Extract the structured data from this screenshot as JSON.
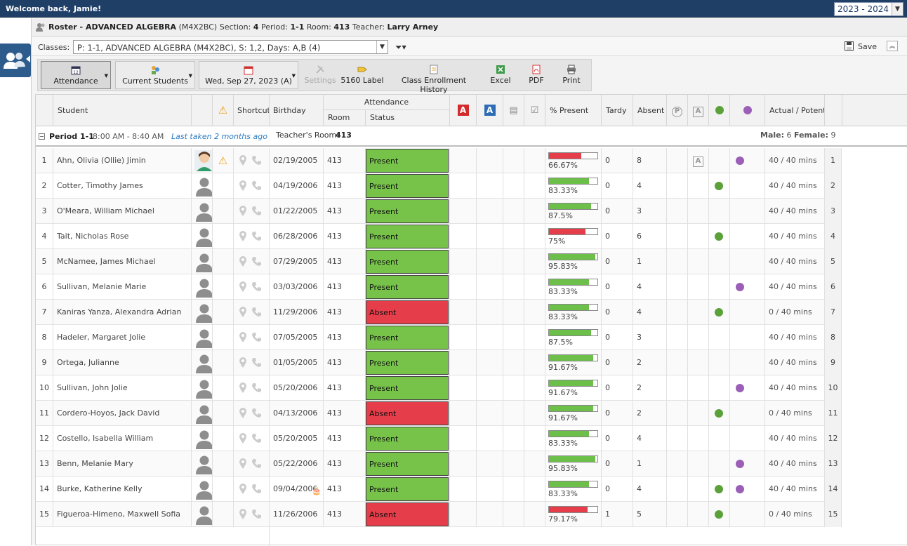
{
  "app": {
    "welcome": "Welcome back, Jamie!",
    "year": "2023 - 2024"
  },
  "title": {
    "prefix": "Roster - ",
    "course": "ADVANCED ALGEBRA",
    "code": "(M4X2BC)",
    "section_label": "Section:",
    "section": "4",
    "period_label": "Period:",
    "period": "1-1",
    "room_label": "Room:",
    "room": "413",
    "teacher_label": "Teacher:",
    "teacher": "Larry Arney"
  },
  "classes": {
    "label": "Classes:",
    "selected": "P: 1-1, ADVANCED ALGEBRA (M4X2BC), S: 1,2, Days: A,B (4)"
  },
  "save_label": "Save",
  "toolbar": {
    "attendance": "Attendance",
    "current_students": "Current Students",
    "date": "Wed, Sep 27, 2023 (A)",
    "settings": "Settings",
    "label5160": "5160 Label",
    "history": "Class Enrollment History",
    "excel": "Excel",
    "pdf": "PDF",
    "print": "Print"
  },
  "columns": {
    "student": "Student",
    "shortcuts": "Shortcuts",
    "birthday": "Birthday",
    "attendance": "Attendance",
    "room": "Room",
    "status": "Status",
    "present_pct": "% Present",
    "tardy": "Tardy",
    "absent": "Absent",
    "actual": "Actual / Potential"
  },
  "period": {
    "name": "Period 1-1",
    "time": "8:00 AM - 8:40 AM",
    "last_taken": "Last taken 2 months ago",
    "teacher_room_label": "Teacher's Room:",
    "teacher_room": "413",
    "male_label": "Male:",
    "male": "6",
    "female_label": "Female:",
    "female": "9"
  },
  "students": [
    {
      "n": "1",
      "name": "Ahn, Olivia (Ollie) Jimin",
      "bday": "02/19/2005",
      "room": "413",
      "status": "Present",
      "pct": "66.67%",
      "pv": 66.67,
      "tardy": "0",
      "absent": "8",
      "warn": true,
      "photo": true,
      "aicon": true,
      "green": false,
      "purple": true,
      "actual": "40",
      "pot": "40 mins"
    },
    {
      "n": "2",
      "name": "Cotter, Timothy James",
      "bday": "04/19/2006",
      "room": "413",
      "status": "Present",
      "pct": "83.33%",
      "pv": 83.33,
      "tardy": "0",
      "absent": "4",
      "green": true,
      "purple": false,
      "actual": "40",
      "pot": "40 mins"
    },
    {
      "n": "3",
      "name": "O'Meara, William Michael",
      "bday": "01/22/2005",
      "room": "413",
      "status": "Present",
      "pct": "87.5%",
      "pv": 87.5,
      "tardy": "0",
      "absent": "3",
      "green": false,
      "purple": false,
      "actual": "40",
      "pot": "40 mins"
    },
    {
      "n": "4",
      "name": "Tait, Nicholas Rose",
      "bday": "06/28/2006",
      "room": "413",
      "status": "Present",
      "pct": "75%",
      "pv": 75,
      "tardy": "0",
      "absent": "6",
      "green": true,
      "purple": false,
      "actual": "40",
      "pot": "40 mins"
    },
    {
      "n": "5",
      "name": "McNamee, James Michael",
      "bday": "07/29/2005",
      "room": "413",
      "status": "Present",
      "pct": "95.83%",
      "pv": 95.83,
      "tardy": "0",
      "absent": "1",
      "green": false,
      "purple": false,
      "actual": "40",
      "pot": "40 mins"
    },
    {
      "n": "6",
      "name": "Sullivan, Melanie Marie",
      "bday": "03/03/2006",
      "room": "413",
      "status": "Present",
      "pct": "83.33%",
      "pv": 83.33,
      "tardy": "0",
      "absent": "4",
      "green": false,
      "purple": true,
      "actual": "40",
      "pot": "40 mins"
    },
    {
      "n": "7",
      "name": "Kaniras Yanza, Alexandra Adrian",
      "bday": "11/29/2006",
      "room": "413",
      "status": "Absent",
      "pct": "83.33%",
      "pv": 83.33,
      "tardy": "0",
      "absent": "4",
      "green": true,
      "purple": false,
      "actual": "0",
      "pot": "40 mins"
    },
    {
      "n": "8",
      "name": "Hadeler, Margaret Jolie",
      "bday": "07/05/2005",
      "room": "413",
      "status": "Present",
      "pct": "87.5%",
      "pv": 87.5,
      "tardy": "0",
      "absent": "3",
      "green": false,
      "purple": false,
      "actual": "40",
      "pot": "40 mins"
    },
    {
      "n": "9",
      "name": "Ortega, Julianne",
      "bday": "01/05/2005",
      "room": "413",
      "status": "Present",
      "pct": "91.67%",
      "pv": 91.67,
      "tardy": "0",
      "absent": "2",
      "green": false,
      "purple": false,
      "actual": "40",
      "pot": "40 mins"
    },
    {
      "n": "10",
      "name": "Sullivan, John Jolie",
      "bday": "05/20/2006",
      "room": "413",
      "status": "Present",
      "pct": "91.67%",
      "pv": 91.67,
      "tardy": "0",
      "absent": "2",
      "green": false,
      "purple": true,
      "actual": "40",
      "pot": "40 mins"
    },
    {
      "n": "11",
      "name": "Cordero-Hoyos, Jack David",
      "bday": "04/13/2006",
      "room": "413",
      "status": "Absent",
      "pct": "91.67%",
      "pv": 91.67,
      "tardy": "0",
      "absent": "2",
      "green": true,
      "purple": false,
      "actual": "0",
      "pot": "40 mins"
    },
    {
      "n": "12",
      "name": "Costello, Isabella William",
      "bday": "05/20/2005",
      "room": "413",
      "status": "Present",
      "pct": "83.33%",
      "pv": 83.33,
      "tardy": "0",
      "absent": "4",
      "green": false,
      "purple": false,
      "actual": "40",
      "pot": "40 mins"
    },
    {
      "n": "13",
      "name": "Benn, Melanie Mary",
      "bday": "05/22/2006",
      "room": "413",
      "status": "Present",
      "pct": "95.83%",
      "pv": 95.83,
      "tardy": "0",
      "absent": "1",
      "green": false,
      "purple": true,
      "actual": "40",
      "pot": "40 mins"
    },
    {
      "n": "14",
      "name": "Burke, Katherine Kelly",
      "bday": "09/04/2006",
      "room": "413",
      "status": "Present",
      "pct": "83.33%",
      "pv": 83.33,
      "tardy": "0",
      "absent": "4",
      "green": true,
      "purple": true,
      "actual": "40",
      "pot": "40 mins",
      "cake": true
    },
    {
      "n": "15",
      "name": "Figueroa-Himeno, Maxwell Sofia",
      "bday": "11/26/2006",
      "room": "413",
      "status": "Absent",
      "pct": "79.17%",
      "pv": 79.17,
      "tardy": "1",
      "absent": "5",
      "green": true,
      "purple": false,
      "actual": "0",
      "pot": "40 mins"
    }
  ],
  "colors": {
    "present": "#77c34a",
    "absent": "#e63d4a",
    "bar_good": "#6cc04a",
    "bar_low": "#e63d4a",
    "header_bg": "#1f3f67"
  }
}
